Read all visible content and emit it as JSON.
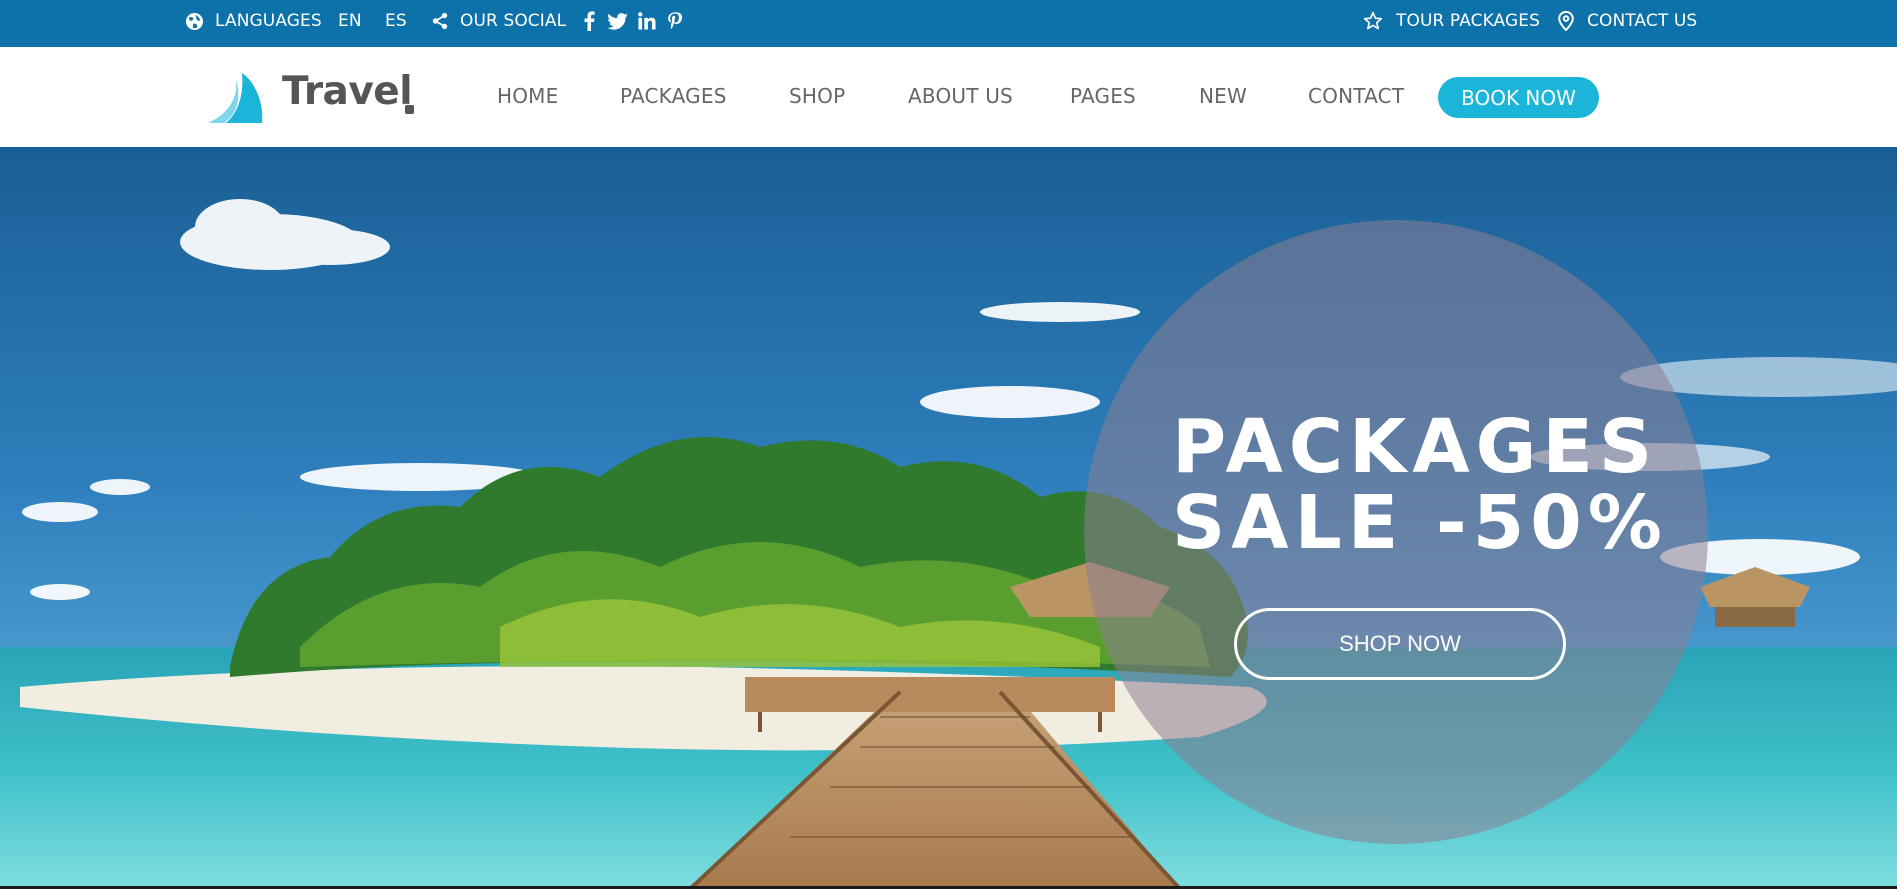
{
  "topbar": {
    "languages_label": "LANGUAGES",
    "lang_en": "EN",
    "lang_es": "ES",
    "social_label": "OUR SOCIAL",
    "social_icons": [
      "facebook-icon",
      "twitter-icon",
      "linkedin-icon",
      "pinterest-icon"
    ],
    "tour_packages_label": "TOUR PACKAGES",
    "contact_us_label": "CONTACT US"
  },
  "logo": {
    "text": "Travel",
    "suffix": "."
  },
  "nav": {
    "items": [
      "HOME",
      "PACKAGES",
      "SHOP",
      "ABOUT US",
      "PAGES",
      "NEW",
      "CONTACT"
    ],
    "cta": "BOOK NOW"
  },
  "hero": {
    "headline_line1": "PACKAGES",
    "headline_line2": "SALE -50%",
    "button": "SHOP NOW"
  },
  "colors": {
    "topbar_bg": "#0d72a9",
    "accent": "#1ab5d8",
    "nav_text": "#666666",
    "logo_text": "#555555"
  }
}
